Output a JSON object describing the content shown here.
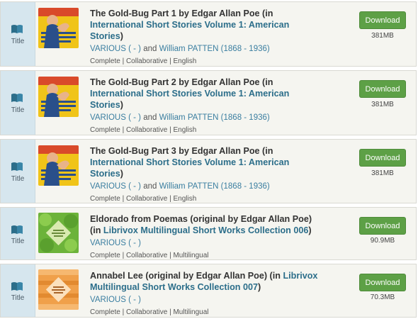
{
  "results": [
    {
      "type_label": "Title",
      "cover": "rosie",
      "title": "The Gold-Bug Part 1 by Edgar Allan Poe (in ",
      "collection": "International Short Stories Volume 1: American Stories",
      "title_end": ")",
      "author1": "VARIOUS ( - )",
      "and": "and",
      "author2": "William PATTEN (1868 - 1936)",
      "meta": "Complete | Collaborative | English",
      "download": "Download",
      "size": "381MB"
    },
    {
      "type_label": "Title",
      "cover": "rosie",
      "title": "The Gold-Bug Part 2 by Edgar Allan Poe (in ",
      "collection": "International Short Stories Volume 1: American Stories",
      "title_end": ")",
      "author1": "VARIOUS ( - )",
      "and": "and",
      "author2": "William PATTEN (1868 - 1936)",
      "meta": "Complete | Collaborative | English",
      "download": "Download",
      "size": "381MB"
    },
    {
      "type_label": "Title",
      "cover": "rosie",
      "title": "The Gold-Bug Part 3 by Edgar Allan Poe (in ",
      "collection": "International Short Stories Volume 1: American Stories",
      "title_end": ")",
      "author1": "VARIOUS ( - )",
      "and": "and",
      "author2": "William PATTEN (1868 - 1936)",
      "meta": "Complete | Collaborative | English",
      "download": "Download",
      "size": "381MB"
    },
    {
      "type_label": "Title",
      "cover": "green",
      "title": "Eldorado from Poemas (original by Edgar Allan Poe) (in ",
      "collection": "Librivox Multilingual Short Works Collection 006",
      "title_end": ")",
      "author1": "VARIOUS ( - )",
      "meta": "Complete | Collaborative | Multilingual",
      "download": "Download",
      "size": "90.9MB"
    },
    {
      "type_label": "Title",
      "cover": "orange",
      "title": "Annabel Lee (original by Edgar Allan Poe) (in ",
      "collection": "Librivox Multilingual Short Works Collection 007",
      "title_end": ")",
      "author1": "VARIOUS ( - )",
      "meta": "Complete | Collaborative | Multilingual",
      "download": "Download",
      "size": "70.3MB"
    }
  ],
  "colors": {
    "download": "#5da046",
    "link": "#3a7ea0",
    "collection_link": "#2c6e8a",
    "type_cell": "#d6e6ee"
  }
}
